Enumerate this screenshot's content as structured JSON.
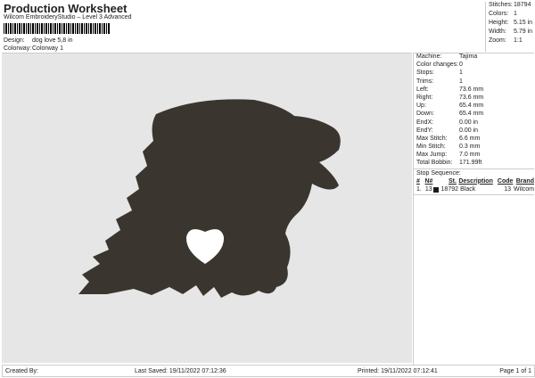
{
  "header": {
    "title": "Production Worksheet",
    "software": "Wilcom EmbroideryStudio – Level 3 Advanced",
    "design_label": "Design:",
    "design_value": "dog love 5,8 in",
    "colorway_label": "Colorway:",
    "colorway_value": "Colorway 1"
  },
  "stats": [
    {
      "k": "Stitches:",
      "v": "18794"
    },
    {
      "k": "Colors:",
      "v": "1"
    },
    {
      "k": "Height:",
      "v": "5.15 in"
    },
    {
      "k": "Width:",
      "v": "5.79 in"
    },
    {
      "k": "Zoom:",
      "v": "1:1"
    }
  ],
  "details": [
    {
      "k": "Machine:",
      "v": "Tajima"
    },
    {
      "k": "Color changes:",
      "v": "0"
    },
    {
      "k": "Stops:",
      "v": "1"
    },
    {
      "k": "Trims:",
      "v": "1"
    },
    {
      "k": "Left:",
      "v": "73.6 mm"
    },
    {
      "k": "Right:",
      "v": "73.6 mm"
    },
    {
      "k": "Up:",
      "v": "65.4 mm"
    },
    {
      "k": "Down:",
      "v": "65.4 mm"
    },
    {
      "k": "EndX:",
      "v": "0.00 in"
    },
    {
      "k": "EndY:",
      "v": "0.00 in"
    },
    {
      "k": "Max Stitch:",
      "v": "6.6 mm"
    },
    {
      "k": "Min Stitch:",
      "v": "0.3 mm"
    },
    {
      "k": "Max Jump:",
      "v": "7.0 mm"
    },
    {
      "k": "Total Bobbin:",
      "v": "171.99ft"
    }
  ],
  "stop_sequence": {
    "label": "Stop Sequence:",
    "headers": [
      "#",
      "N#",
      "St.",
      "Description",
      "Code",
      "Brand"
    ],
    "rows": [
      {
        "num": "1.",
        "n": "13",
        "swatch": "#1a1a1a",
        "st": "18792",
        "desc": "Black",
        "code": "13",
        "brand": "Wilcom"
      }
    ]
  },
  "footer": {
    "created": "Created By:",
    "saved": "Last Saved: 19/11/2022 07:12:36",
    "printed": "Printed: 19/11/2022 07:12:41",
    "page": "Page 1 of 1"
  },
  "colors": {
    "design_fill": "#3a362f",
    "canvas": "#e6e6e6"
  }
}
